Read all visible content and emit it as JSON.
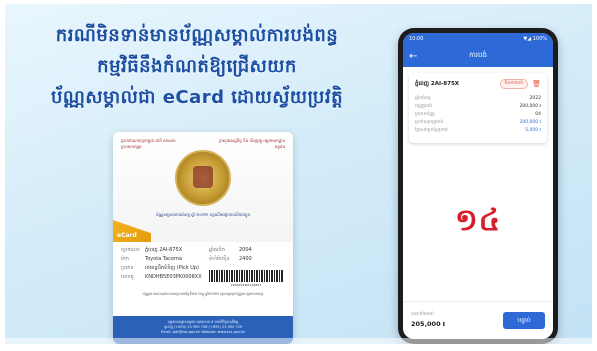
{
  "headline": {
    "line1": "ករណីមិនទាន់មានប័ណ្ណសម្គាល់ការបង់ពន្ធ",
    "line2": "កម្មវិធីនឹងកំណត់ឱ្យជ្រើសយក",
    "line3": "ប័ណ្ណសម្គាល់ជា eCard ដោយស្វ័យប្រវត្តិ"
  },
  "card": {
    "header_left": "ព្រះរាជាណាចក្រកម្ពុជា ជាតិ សាសនា ព្រះមហាក្សត្រ",
    "header_right": "ក្រសួងសេដ្ឋកិច្ច និង ហិរញ្ញវត្ថុ អគ្គនាយកដ្ឋានពន្ធដារ",
    "ministry": "ប័ណ្ណសម្គាល់ការបង់ពន្ធ ឆ្នាំ ២០២២ ពន្ធលើមធ្យោបាយដឹកជញ្ជូន",
    "ecard_tag": "eCard",
    "rows": [
      {
        "k": "ស្លាកលេខ",
        "v": "ភ្នំពេញ 2AI-875X",
        "k2": "ឆ្នាំផលិត",
        "v2": "2004"
      },
      {
        "k": "ម៉ាក",
        "v": "Toyota Tacoma",
        "k2": "ទំហំម៉ាស៊ីន",
        "v2": "2400"
      },
      {
        "k": "ប្រភេទ",
        "v": "រថយន្តដឹកទំនិញ (Pick Up)",
        "k2": "",
        "v2": ""
      },
      {
        "k": "លេខតួ",
        "v": "KNDHB5E03PK0008XX",
        "k2": "",
        "v2": ""
      }
    ],
    "barcode_num": "2100023451234567",
    "note": "ប័ណ្ណនេះមានសុពលភាពរហូតដល់ថ្ងៃទី៣១ ខែធ្នូ ឆ្នាំ២០២២ សូមរក្សាទុកប័ណ្ណនេះក្នុងយានយន្ត",
    "footer": [
      "អគ្គនាយកដ្ឋានពន្ធដារ អគារលេខ ៩ មហាវិថីព្រះមុនីវង្ស",
      "ទូរស័ព្ទ (+855) 23 990 758 (+855) 23 990 759",
      "Email: gdt@tax.gov.kh Website: www.tax.gov.kh"
    ]
  },
  "phone": {
    "status_time": "10:00",
    "status_icons": "▼◢ 100%",
    "back_icon": "←",
    "title": "ការបង់",
    "plate": "ភ្នំពេញ 2AI-875X",
    "badge": "មិនទាន់បង់",
    "delete_icon": "🗑",
    "rows": [
      {
        "k": "ឆ្នាំបង់ពន្ធ",
        "v": "2022",
        "blue": false
      },
      {
        "k": "ពន្ធត្រូវបង់",
        "v": "200,000 ៛",
        "blue": false
      },
      {
        "k": "ប្រភេទប័ណ្ណ",
        "v": "04",
        "blue": false
      },
      {
        "k": "ប្រាក់សរុបត្រូវបង់",
        "v": "200,000 ៛",
        "blue": true
      },
      {
        "k": "ថ្លៃសេវាប្រព័ន្ធទូទាត់",
        "v": "5,000 ៛",
        "blue": true
      }
    ],
    "step_number": "១៤",
    "total_label": "សរុបទាំងអស់",
    "total_value": "205,000 ៛",
    "pay_button": "បន្ទាប់"
  }
}
